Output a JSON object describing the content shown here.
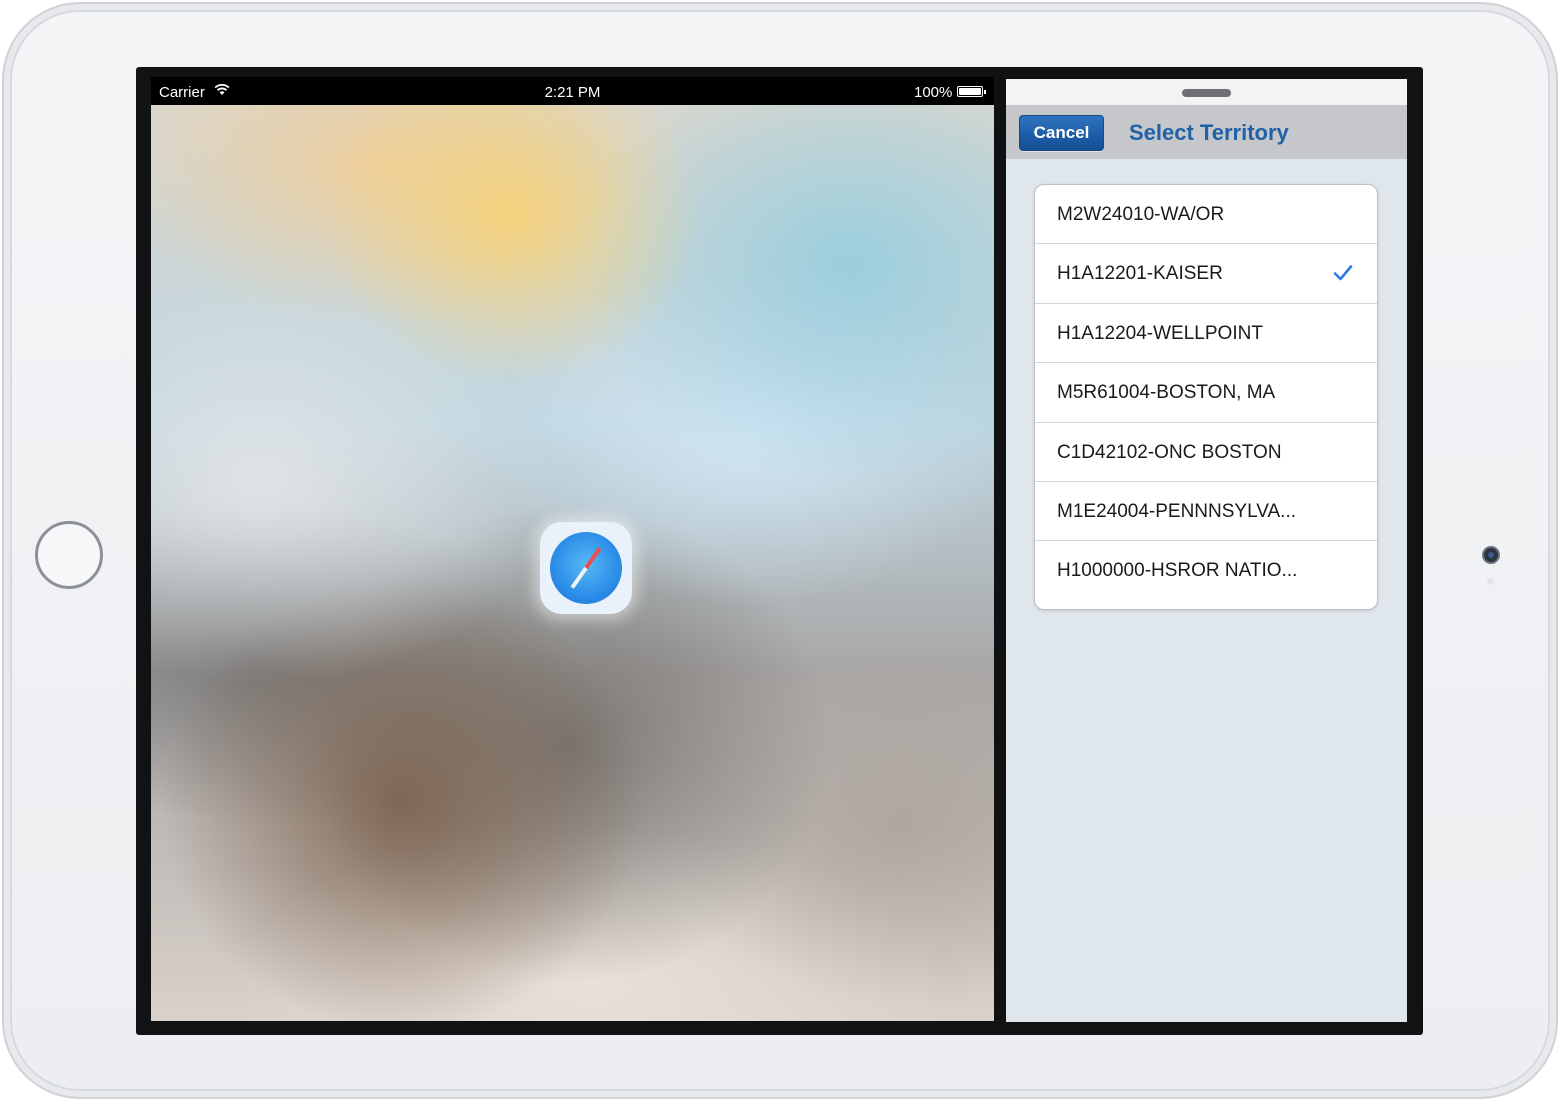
{
  "status_bar": {
    "carrier": "Carrier",
    "time": "2:21 PM",
    "battery_percent": "100%",
    "battery_level": 1.0
  },
  "background_app": {
    "icon": "safari-compass-icon"
  },
  "slide_over": {
    "cancel_label": "Cancel",
    "title": "Select Territory",
    "selected_index": 1,
    "items": [
      {
        "label": "M2W24010-WA/OR",
        "selected": false
      },
      {
        "label": "H1A12201-KAISER",
        "selected": true
      },
      {
        "label": "H1A12204-WELLPOINT",
        "selected": false
      },
      {
        "label": "M5R61004-BOSTON, MA",
        "selected": false
      },
      {
        "label": "C1D42102-ONC BOSTON",
        "selected": false
      },
      {
        "label": "M1E24004-PENNNSYLVA...",
        "selected": false
      },
      {
        "label": "H1000000-HSROR NATIO...",
        "selected": false
      }
    ]
  },
  "colors": {
    "accent": "#1f62a8",
    "cancel_button": "#1d5ea8",
    "checkmark": "#2a7de1"
  }
}
